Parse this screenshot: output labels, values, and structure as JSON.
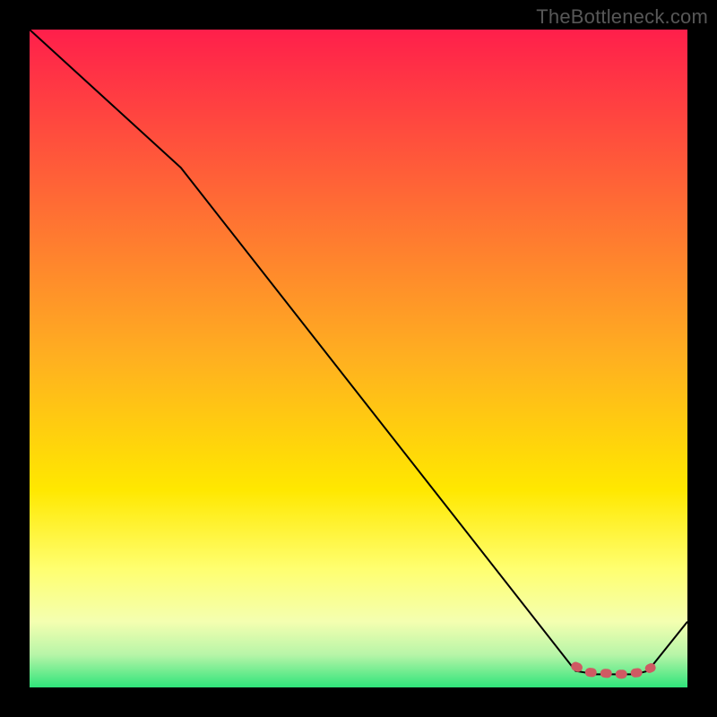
{
  "attribution": "TheBottleneck.com",
  "chart_data": {
    "type": "line",
    "title": "",
    "xlabel": "",
    "ylabel": "",
    "xlim": [
      0,
      100
    ],
    "ylim": [
      0,
      100
    ],
    "grid": false,
    "legend": null,
    "background_gradient": {
      "stops": [
        {
          "offset": 0.0,
          "color": "#ff1f4b"
        },
        {
          "offset": 0.5,
          "color": "#ffb020"
        },
        {
          "offset": 0.7,
          "color": "#ffe800"
        },
        {
          "offset": 0.82,
          "color": "#ffff70"
        },
        {
          "offset": 0.9,
          "color": "#f4ffb0"
        },
        {
          "offset": 0.95,
          "color": "#b8f5a8"
        },
        {
          "offset": 1.0,
          "color": "#2fe47a"
        }
      ]
    },
    "series": [
      {
        "name": "bottleneck-curve",
        "style": "thin-black",
        "points": [
          {
            "x": 0,
            "y": 100
          },
          {
            "x": 23,
            "y": 79
          },
          {
            "x": 83,
            "y": 2.5
          },
          {
            "x": 86,
            "y": 2
          },
          {
            "x": 92,
            "y": 2
          },
          {
            "x": 94,
            "y": 2.5
          },
          {
            "x": 100,
            "y": 10
          }
        ]
      },
      {
        "name": "optimal-zone-marker",
        "style": "thick-red-dashed",
        "points": [
          {
            "x": 83,
            "y": 3.2
          },
          {
            "x": 85,
            "y": 2.3
          },
          {
            "x": 90,
            "y": 2.0
          },
          {
            "x": 93,
            "y": 2.3
          },
          {
            "x": 94.5,
            "y": 3.0
          }
        ]
      }
    ]
  }
}
